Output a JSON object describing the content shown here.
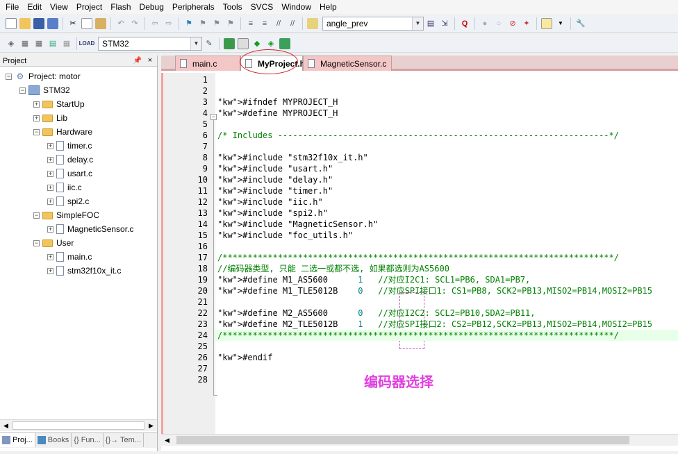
{
  "menu": [
    "File",
    "Edit",
    "View",
    "Project",
    "Flash",
    "Debug",
    "Peripherals",
    "Tools",
    "SVCS",
    "Window",
    "Help"
  ],
  "toolbar": {
    "find_combo_value": "angle_prev",
    "target_combo_value": "STM32",
    "icons": [
      "new-file",
      "open",
      "save",
      "save-all",
      "cut",
      "copy",
      "paste",
      "undo",
      "redo",
      "nav-back",
      "nav-forward",
      "bookmark",
      "bookmark-prev",
      "bookmark-next",
      "bookmark-clear",
      "indent",
      "unindent",
      "comment",
      "uncomment",
      "find-in-files",
      "find",
      "find-options",
      "debug-start",
      "breakpoint",
      "breakpoint-disable",
      "breakpoints-kill",
      "breakpoints-toggle",
      "window-config",
      "configure-tools"
    ],
    "build_icons": [
      "translate",
      "build",
      "rebuild",
      "batch-build",
      "stop-build",
      "download",
      "target-options",
      "manage-components",
      "pack-installer",
      "select-packs",
      "manage-rte"
    ]
  },
  "project_panel": {
    "title": "Project",
    "pin": "p",
    "close": "×",
    "tree": [
      {
        "label": "Project: motor",
        "type": "project",
        "level": 0
      },
      {
        "label": "STM32",
        "type": "target",
        "level": 1
      },
      {
        "label": "StartUp",
        "type": "folder",
        "level": 2
      },
      {
        "label": "Lib",
        "type": "folder",
        "level": 2
      },
      {
        "label": "Hardware",
        "type": "folder",
        "level": 2
      },
      {
        "label": "timer.c",
        "type": "file",
        "level": 3
      },
      {
        "label": "delay.c",
        "type": "file",
        "level": 3
      },
      {
        "label": "usart.c",
        "type": "file",
        "level": 3
      },
      {
        "label": "iic.c",
        "type": "file",
        "level": 3
      },
      {
        "label": "spi2.c",
        "type": "file",
        "level": 3
      },
      {
        "label": "SimpleFOC",
        "type": "folder",
        "level": 2
      },
      {
        "label": "MagneticSensor.c",
        "type": "file",
        "level": 3
      },
      {
        "label": "User",
        "type": "folder",
        "level": 2
      },
      {
        "label": "main.c",
        "type": "file",
        "level": 3
      },
      {
        "label": "stm32f10x_it.c",
        "type": "file",
        "level": 3
      }
    ],
    "tabs": [
      "Proj...",
      "Books",
      "{} Fun...",
      "{}→ Tem..."
    ]
  },
  "editor": {
    "tabs": [
      "main.c",
      "MyProject.h",
      "MagneticSensor.c"
    ],
    "active_tab": "MyProject.h",
    "lines": [
      "",
      "",
      "#ifndef MYPROJECT_H",
      "#define MYPROJECT_H",
      "",
      "/* Includes ------------------------------------------------------------------*/",
      "",
      "#include \"stm32f10x_it.h\"",
      "#include \"usart.h\"",
      "#include \"delay.h\"",
      "#include \"timer.h\"",
      "#include \"iic.h\"",
      "#include \"spi2.h\"",
      "#include \"MagneticSensor.h\"",
      "#include \"foc_utils.h\"",
      "",
      "/******************************************************************************/",
      "//编码器类型, 只能 二选一或都不选, 如果都选则为AS5600",
      "#define M1_AS5600      1   //对应I2C1: SCL1=PB6, SDA1=PB7,",
      "#define M1_TLE5012B    0   //对应SPI接口1: CS1=PB8, SCK2=PB13,MISO2=PB14,MOSI2=PB15",
      "",
      "#define M2_AS5600      0   //对应I2C2: SCL2=PB10,SDA2=PB11,",
      "#define M2_TLE5012B    1   //对应SPI接口2: CS2=PB12,SCK2=PB13,MISO2=PB14,MOSI2=PB15",
      "/******************************************************************************/",
      "",
      "#endif",
      "",
      ""
    ],
    "annotation": "编码器选择"
  }
}
